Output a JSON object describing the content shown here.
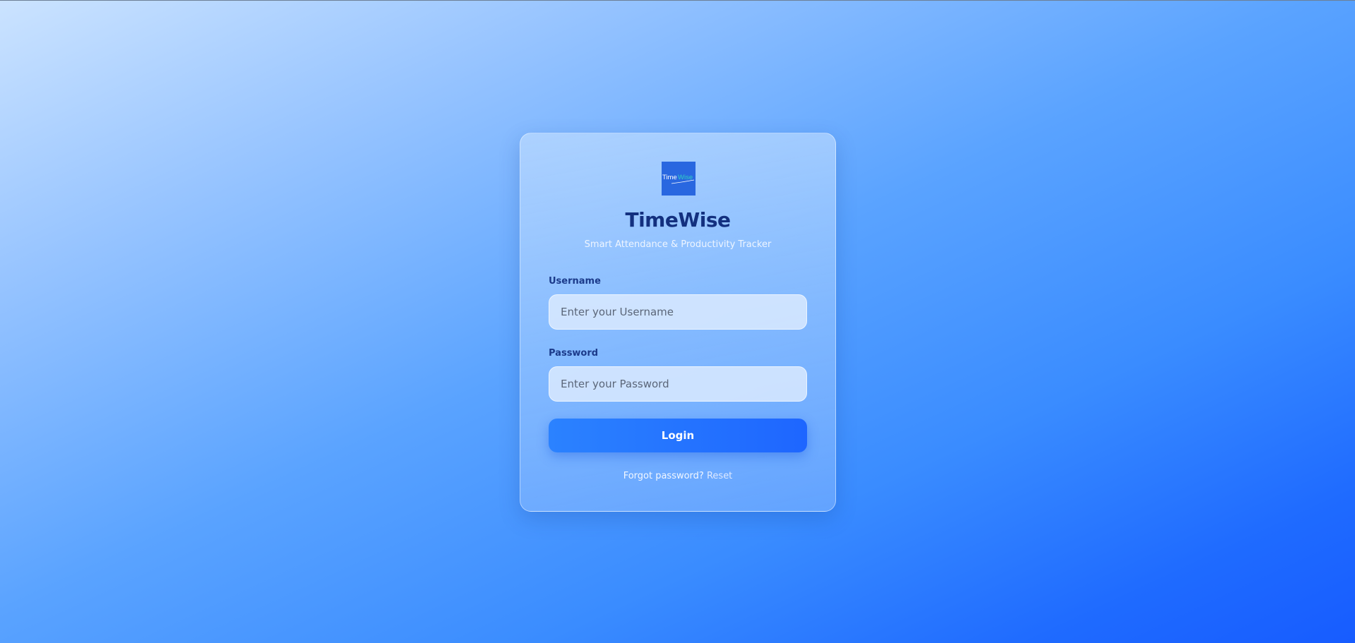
{
  "logo": {
    "text_part1": "Time",
    "text_part2": "Wise",
    "icon": "timewise-logo",
    "background": "#2967e0"
  },
  "brand": {
    "title": "TimeWise",
    "tagline": "Smart Attendance & Productivity Tracker"
  },
  "form": {
    "username_label": "Username",
    "username_placeholder": "Enter your Username",
    "password_label": "Password",
    "password_placeholder": "Enter your Password",
    "login_label": "Login"
  },
  "footer": {
    "forgot_text": "Forgot password?",
    "reset_label": "Reset"
  },
  "colors": {
    "accent": "#1e66ff",
    "title": "#13307f"
  }
}
